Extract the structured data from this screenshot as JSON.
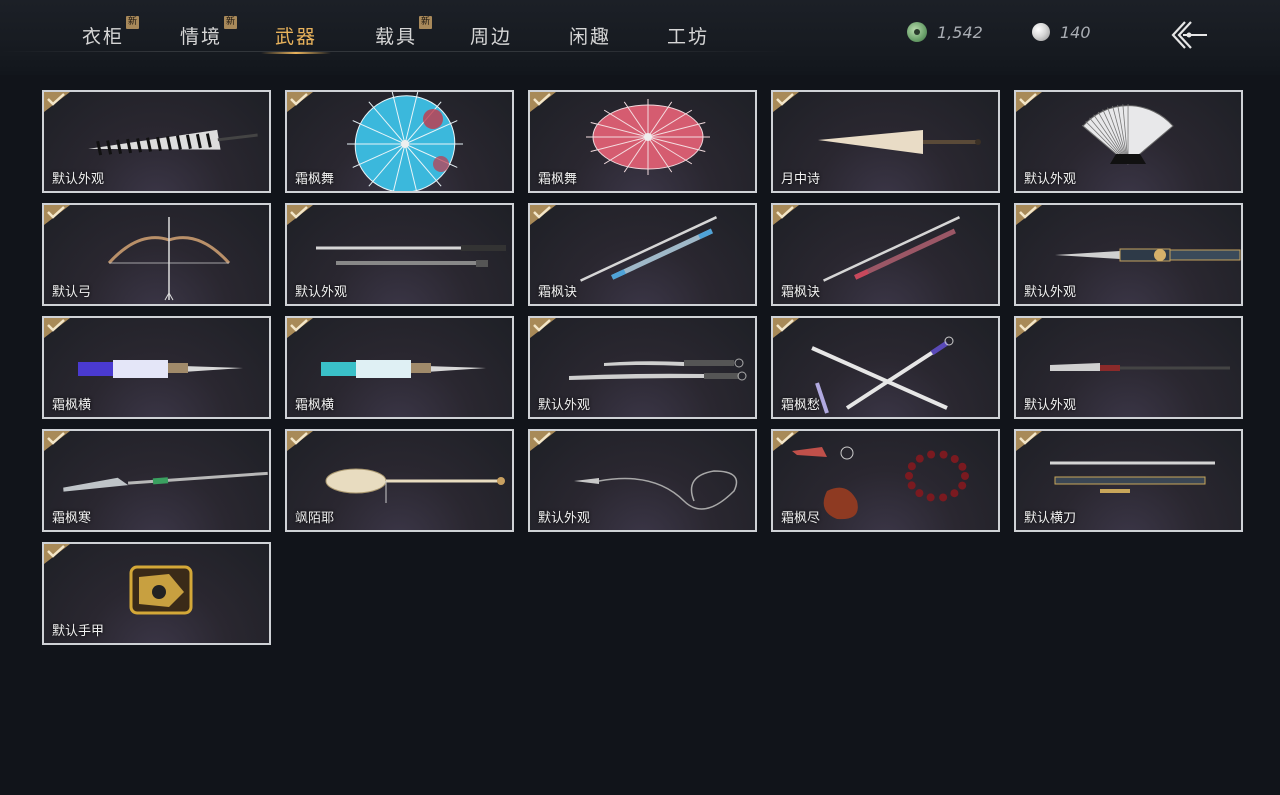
{
  "tabs": [
    {
      "label": "衣柜",
      "badge": "新"
    },
    {
      "label": "情境",
      "badge": "新"
    },
    {
      "label": "武器",
      "badge": ""
    },
    {
      "label": "载具",
      "badge": "新"
    },
    {
      "label": "周边",
      "badge": ""
    },
    {
      "label": "闲趣",
      "badge": ""
    },
    {
      "label": "工坊",
      "badge": ""
    }
  ],
  "active_tab": "武器",
  "currency": {
    "jade": {
      "icon": "jade-coin-icon",
      "amount": "1,542"
    },
    "pearl": {
      "icon": "pearl-icon",
      "amount": "140"
    }
  },
  "back_icon": "back-arrow-icon",
  "items": [
    {
      "name": "默认外观",
      "icon": "striped-umbrella",
      "owned": true
    },
    {
      "name": "霜枫舞",
      "icon": "blue-umbrella",
      "owned": true
    },
    {
      "name": "霜枫舞",
      "icon": "red-umbrella",
      "owned": true
    },
    {
      "name": "月中诗",
      "icon": "closed-paper-umbrella",
      "owned": true
    },
    {
      "name": "默认外观",
      "icon": "folding-fan",
      "owned": true
    },
    {
      "name": "默认弓",
      "icon": "bow",
      "owned": true
    },
    {
      "name": "默认外观",
      "icon": "twin-sword",
      "owned": true
    },
    {
      "name": "霜枫诀",
      "icon": "blue-sword",
      "owned": true
    },
    {
      "name": "霜枫诀",
      "icon": "red-sword",
      "owned": true
    },
    {
      "name": "默认外观",
      "icon": "ornate-blade",
      "owned": true
    },
    {
      "name": "霜枫横",
      "icon": "purple-blade",
      "owned": true
    },
    {
      "name": "霜枫横",
      "icon": "teal-blade",
      "owned": true
    },
    {
      "name": "默认外观",
      "icon": "dual-sabres",
      "owned": true
    },
    {
      "name": "霜枫愁",
      "icon": "crossed-blades",
      "owned": true
    },
    {
      "name": "默认外观",
      "icon": "long-glaive",
      "owned": true
    },
    {
      "name": "霜枫寒",
      "icon": "spear",
      "owned": true
    },
    {
      "name": "飒陌耶",
      "icon": "spoon-staff",
      "owned": true
    },
    {
      "name": "默认外观",
      "icon": "rope-dart",
      "owned": true
    },
    {
      "name": "霜枫尽",
      "icon": "beaded-rope-dart",
      "owned": true
    },
    {
      "name": "默认横刀",
      "icon": "hengdao",
      "owned": true
    },
    {
      "name": "默认手甲",
      "icon": "gauntlet",
      "owned": true
    }
  ]
}
